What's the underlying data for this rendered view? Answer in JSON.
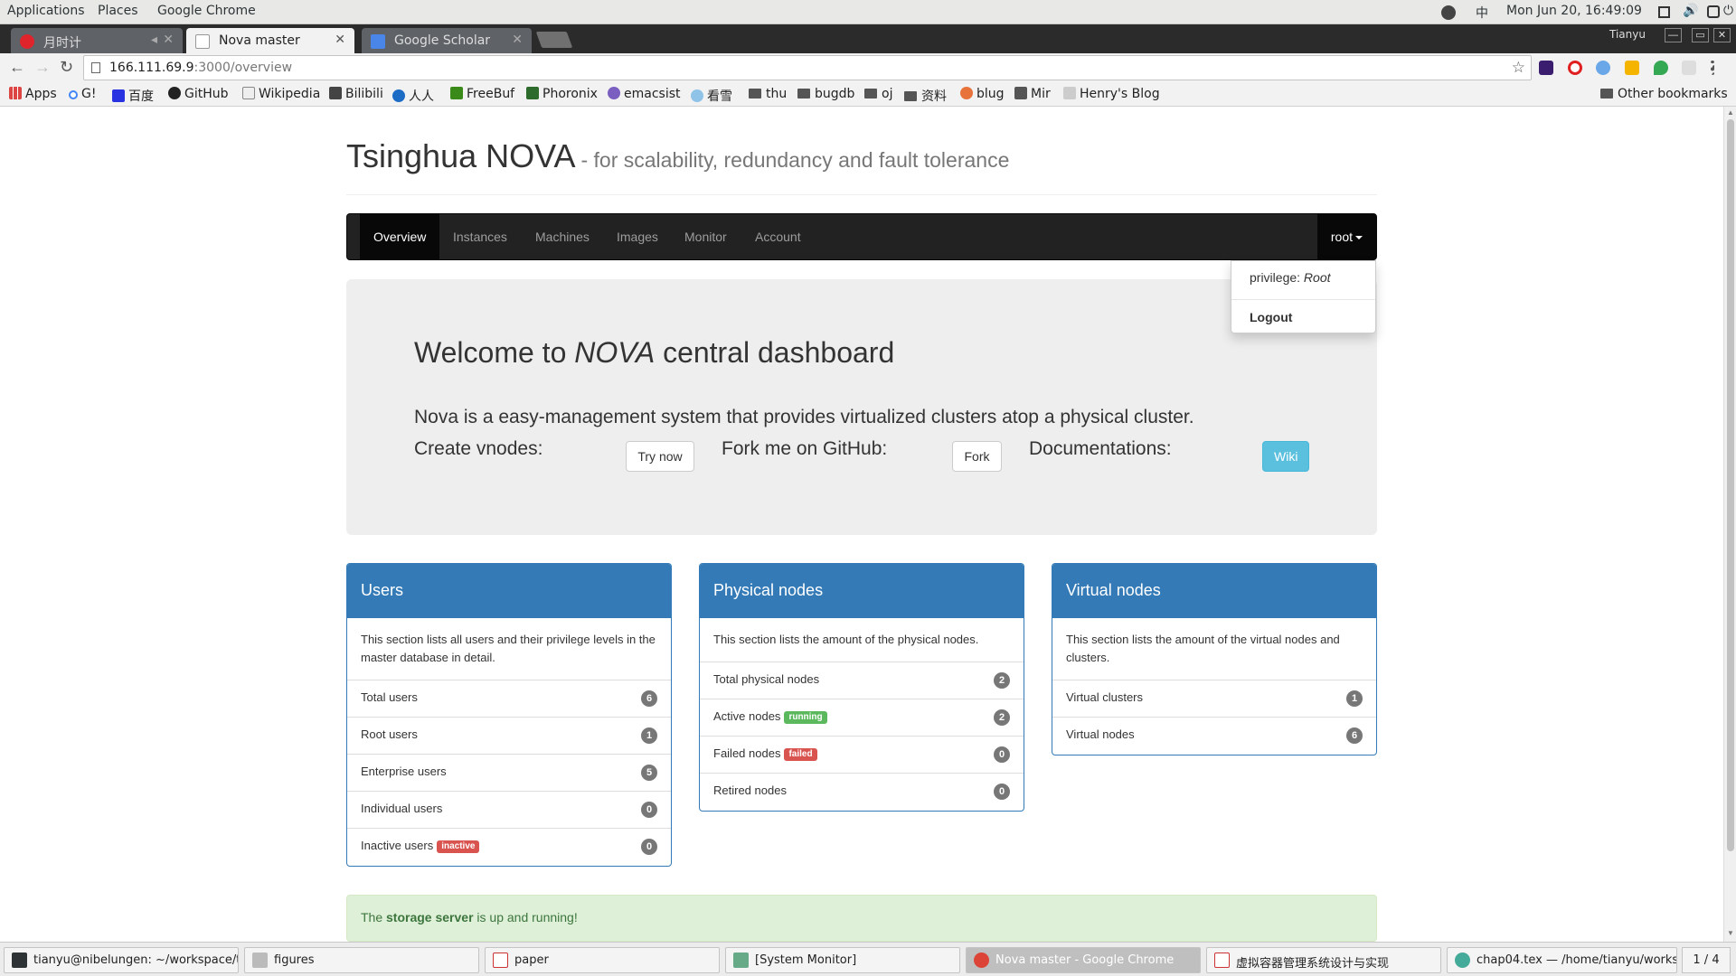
{
  "system_bar": {
    "menus": [
      "Applications",
      "Places",
      "Google Chrome"
    ],
    "input_method": "中",
    "clock": "Mon Jun 20, 16:49:09"
  },
  "browser": {
    "tabs": [
      {
        "title": "月时计",
        "favicon_color": "#e0242b"
      },
      {
        "title": "Nova master",
        "favicon_color": "#ffffff"
      },
      {
        "title": "Google Scholar",
        "favicon_color": "#4a86e8"
      }
    ],
    "window_user": "Tianyu",
    "url_host": "166.111.69.9",
    "url_path": ":3000/overview",
    "bookmarks": [
      {
        "label": "Apps",
        "icon": "apps-grid-icon"
      },
      {
        "label": "G!",
        "icon": "google-icon"
      },
      {
        "label": "百度",
        "icon": "baidu-icon"
      },
      {
        "label": "GitHub",
        "icon": "github-icon"
      },
      {
        "label": "Wikipedia",
        "icon": "wikipedia-icon"
      },
      {
        "label": "Bilibili",
        "icon": "bilibili-icon"
      },
      {
        "label": "人人",
        "icon": "renren-icon"
      },
      {
        "label": "FreeBuf",
        "icon": "freebuf-icon"
      },
      {
        "label": "Phoronix",
        "icon": "phoronix-icon"
      },
      {
        "label": "emacsist",
        "icon": "emacsist-icon"
      },
      {
        "label": "看雪",
        "icon": "kanxue-icon"
      },
      {
        "label": "thu",
        "icon": "folder-icon"
      },
      {
        "label": "bugdb",
        "icon": "folder-icon"
      },
      {
        "label": "oj",
        "icon": "folder-icon"
      },
      {
        "label": "资料",
        "icon": "folder-icon"
      },
      {
        "label": "blug",
        "icon": "blug-icon"
      },
      {
        "label": "Mir",
        "icon": "mir-icon"
      },
      {
        "label": "Henry's Blog",
        "icon": "henry-blog-icon"
      }
    ],
    "other_bookmarks": "Other bookmarks"
  },
  "page": {
    "title": "Tsinghua NOVA",
    "subtitle": "- for scalability, redundancy and fault tolerance",
    "nav": {
      "items": [
        "Overview",
        "Instances",
        "Machines",
        "Images",
        "Monitor",
        "Account"
      ],
      "active": "Overview",
      "user_menu": "root"
    },
    "dropdown": {
      "privilege_label": "privilege: ",
      "privilege_value": "Root",
      "logout": "Logout"
    },
    "jumbotron": {
      "title_pre": "Welcome to ",
      "title_em": "NOVA",
      "title_post": " central dashboard",
      "lead": "Nova is a easy-management system that provides virtualized clusters atop a physical cluster.",
      "create_label": "Create vnodes:",
      "create_button": "Try now",
      "fork_label": "Fork me on GitHub:",
      "fork_button": "Fork",
      "docs_label": "Documentations:",
      "docs_button": "Wiki"
    },
    "panels": [
      {
        "heading": "Users",
        "body": "This section lists all users and their privilege levels in the master database in detail.",
        "items": [
          {
            "label": "Total users",
            "count": "6",
            "tag": ""
          },
          {
            "label": "Root users",
            "count": "1",
            "tag": ""
          },
          {
            "label": "Enterprise users",
            "count": "5",
            "tag": ""
          },
          {
            "label": "Individual users",
            "count": "0",
            "tag": ""
          },
          {
            "label": "Inactive users",
            "count": "0",
            "tag": "inactive",
            "tag_style": "danger"
          }
        ]
      },
      {
        "heading": "Physical nodes",
        "body": "This section lists the amount of the physical nodes.",
        "items": [
          {
            "label": "Total physical nodes",
            "count": "2",
            "tag": ""
          },
          {
            "label": "Active nodes",
            "count": "2",
            "tag": "running",
            "tag_style": "success"
          },
          {
            "label": "Failed nodes",
            "count": "0",
            "tag": "failed",
            "tag_style": "danger"
          },
          {
            "label": "Retired nodes",
            "count": "0",
            "tag": ""
          }
        ]
      },
      {
        "heading": "Virtual nodes",
        "body": "This section lists the amount of the virtual nodes and clusters.",
        "items": [
          {
            "label": "Virtual clusters",
            "count": "1",
            "tag": ""
          },
          {
            "label": "Virtual nodes",
            "count": "6",
            "tag": ""
          }
        ]
      }
    ],
    "alert": {
      "pre": "The ",
      "strong": "storage server",
      "post": " is up and running!"
    }
  },
  "taskbar": {
    "tasks": [
      {
        "label": "tianyu@nibelungen: ~/workspace/t...",
        "icon": "terminal-icon"
      },
      {
        "label": "figures",
        "icon": "file-manager-icon"
      },
      {
        "label": "paper",
        "icon": "document-viewer-icon"
      },
      {
        "label": "[System Monitor]",
        "icon": "system-monitor-icon"
      },
      {
        "label": "Nova master - Google Chrome",
        "icon": "chrome-icon"
      },
      {
        "label": "虚拟容器管理系统设计与实现",
        "icon": "document-viewer-icon"
      },
      {
        "label": "chap04.tex — /home/tianyu/worksp...",
        "icon": "editor-icon"
      }
    ],
    "workspace": "1 / 4"
  },
  "colors": {
    "brand_blue": "#337ab7",
    "navbar_dark": "#222222",
    "success": "#5cb85c",
    "danger": "#d9534f",
    "info": "#5bc0de",
    "alert_bg": "#dff0d8"
  }
}
